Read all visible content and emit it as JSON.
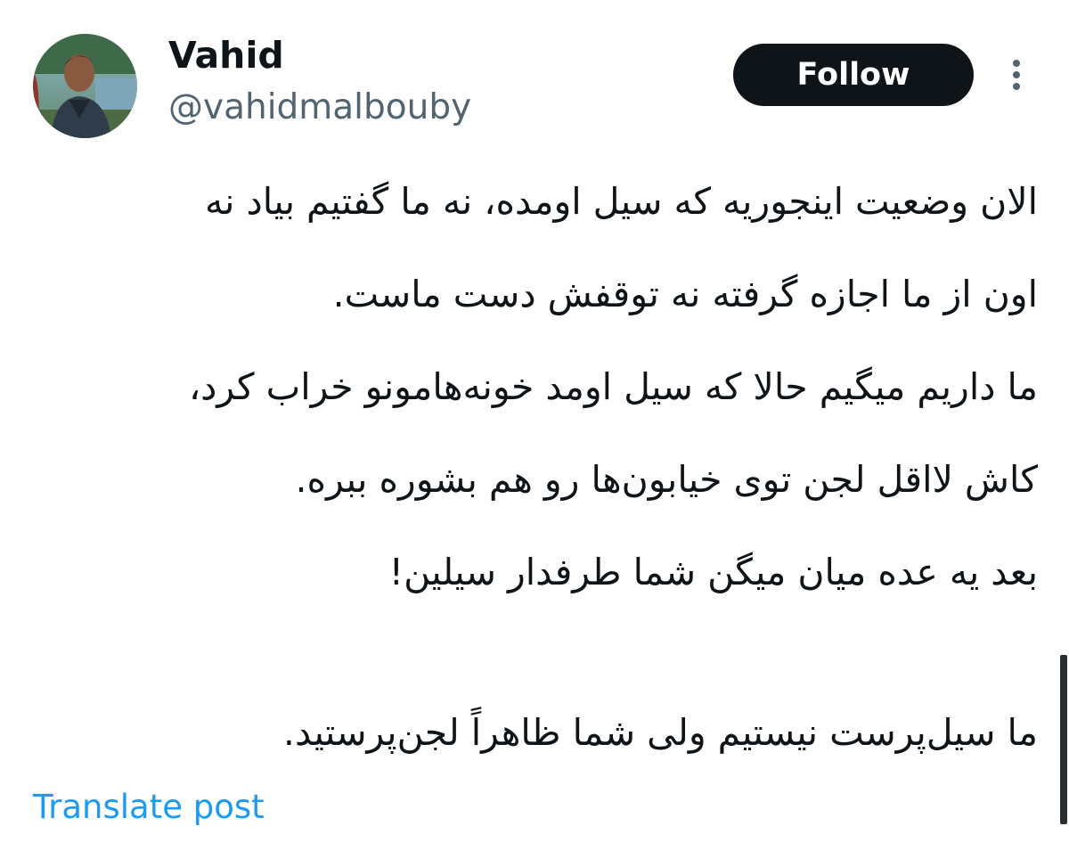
{
  "author": {
    "display_name": "Vahid",
    "handle": "@vahidmalbouby",
    "avatar": "profile-photo"
  },
  "actions": {
    "follow_label": "Follow",
    "more_icon": "more-vertical-icon"
  },
  "tweet": {
    "lines": [
      "الان وضعیت اینجوریه که سیل اومده، نه ما گفتیم بیاد نه",
      "اون از ما اجازه گرفته نه توقفش دست ماست.",
      "ما داریم میگیم حالا که سیل اومد خونه‌هامونو خراب کرد،",
      "کاش لااقل لجن توی خیابون‌ها رو هم بشوره ببره.",
      "بعد یه عده میان میگن شما طرفدار سیلین!",
      "",
      "ما سیل‌پرست نیستیم ولی شما ظاهراً لجن‌پرستید."
    ],
    "translate_label": "Translate post"
  },
  "colors": {
    "text_primary": "#0f1419",
    "text_secondary": "#536471",
    "link": "#1d9bf0",
    "follow_bg": "#0f1419"
  }
}
